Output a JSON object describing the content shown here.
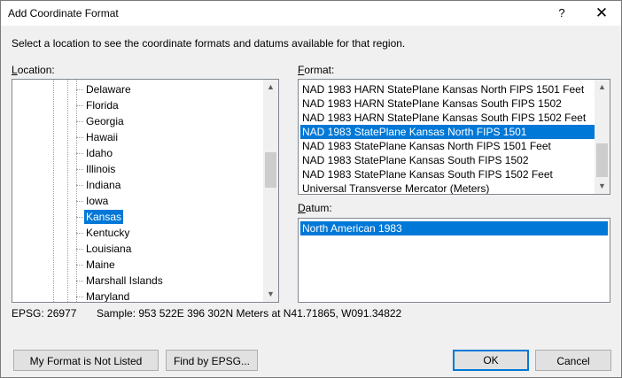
{
  "window": {
    "title": "Add Coordinate Format",
    "help_glyph": "?",
    "close_glyph": "✕"
  },
  "instructions": "Select a location to see the coordinate formats and datums available for that region.",
  "location": {
    "label_accel": "L",
    "label_rest": "ocation:",
    "items": [
      "Delaware",
      "Florida",
      "Georgia",
      "Hawaii",
      "Idaho",
      "Illinois",
      "Indiana",
      "Iowa",
      "Kansas",
      "Kentucky",
      "Louisiana",
      "Maine",
      "Marshall Islands",
      "Maryland"
    ],
    "selected": "Kansas"
  },
  "format": {
    "label_accel": "F",
    "label_rest": "ormat:",
    "items": [
      "NAD 1983 HARN StatePlane Kansas North FIPS 1501 Feet",
      "NAD 1983 HARN StatePlane Kansas South FIPS 1502",
      "NAD 1983 HARN StatePlane Kansas South FIPS 1502 Feet",
      "NAD 1983 StatePlane Kansas North FIPS 1501",
      "NAD 1983 StatePlane Kansas North FIPS 1501 Feet",
      "NAD 1983 StatePlane Kansas South FIPS 1502",
      "NAD 1983 StatePlane Kansas South FIPS 1502 Feet",
      "Universal Transverse Mercator (Meters)"
    ],
    "selected": "NAD 1983 StatePlane Kansas North FIPS 1501"
  },
  "datum": {
    "label_accel": "D",
    "label_rest": "atum:",
    "items": [
      "North American 1983"
    ],
    "selected": "North American 1983"
  },
  "info": {
    "epsg": "EPSG: 26977",
    "sample": "Sample: 953 522E  396 302N Meters at N41.71865, W091.34822"
  },
  "buttons": {
    "not_listed": "My Format is Not Listed",
    "find_epsg": "Find by EPSG...",
    "ok": "OK",
    "cancel": "Cancel"
  }
}
